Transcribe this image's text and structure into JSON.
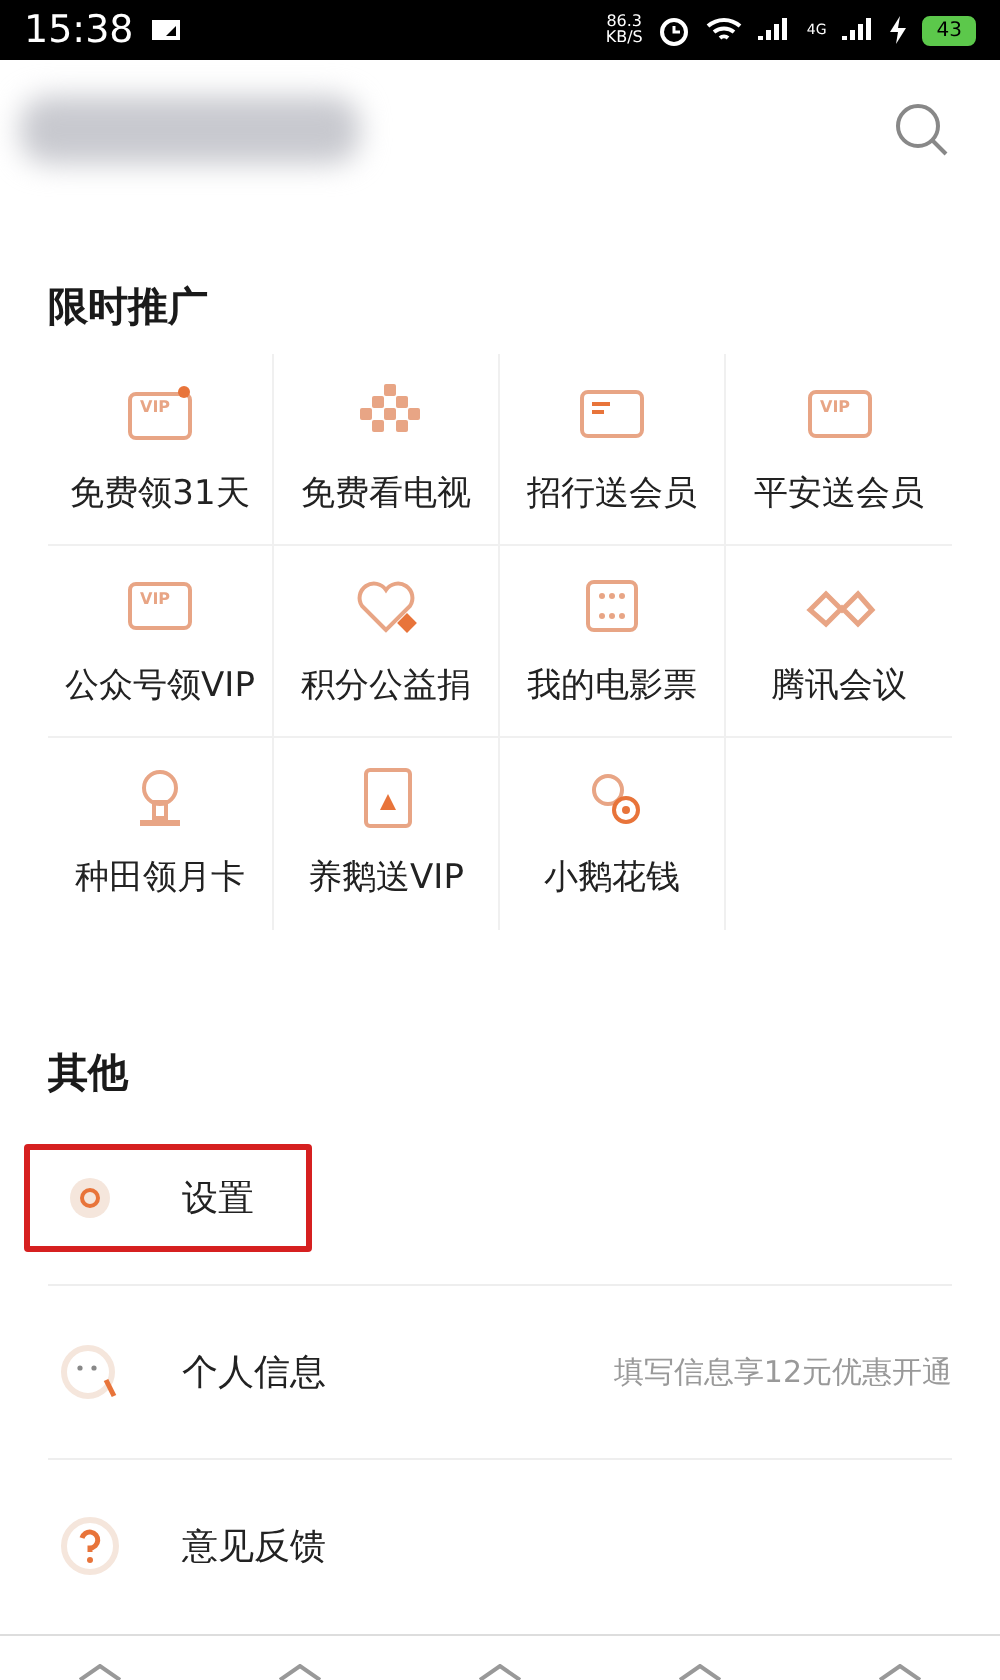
{
  "status_bar": {
    "time": "15:38",
    "speed": "86.3",
    "speed_unit": "KB/S",
    "network": "4G",
    "battery": "43"
  },
  "promo": {
    "title": "限时推广",
    "items": [
      {
        "label": "免费领31天",
        "badge": "VIP"
      },
      {
        "label": "免费看电视"
      },
      {
        "label": "招行送会员"
      },
      {
        "label": "平安送会员",
        "badge": "VIP"
      },
      {
        "label": "公众号领VIP",
        "badge": "VIP"
      },
      {
        "label": "积分公益捐"
      },
      {
        "label": "我的电影票"
      },
      {
        "label": "腾讯会议"
      },
      {
        "label": "种田领月卡"
      },
      {
        "label": "养鹅送VIP"
      },
      {
        "label": "小鹅花钱"
      }
    ]
  },
  "other": {
    "title": "其他",
    "items": [
      {
        "label": "设置",
        "highlighted": true
      },
      {
        "label": "个人信息",
        "hint": "填写信息享12元优惠开通",
        "highlighted": false
      },
      {
        "label": "意见反馈",
        "highlighted": false
      }
    ]
  }
}
